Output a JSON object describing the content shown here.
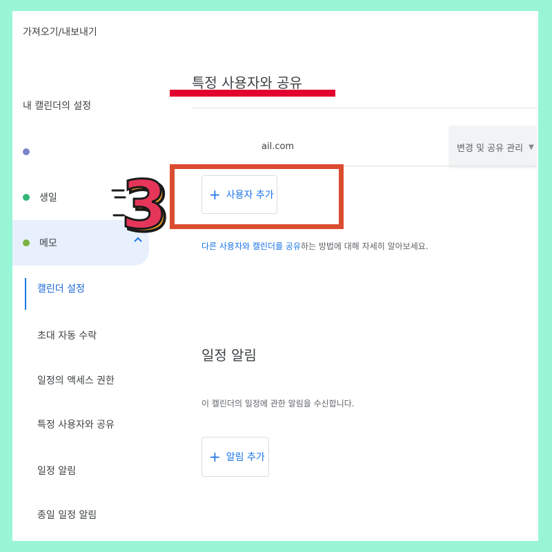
{
  "sidebar": {
    "top_link": "가져오기/내보내기",
    "section_title": "내 캘린더의 설정",
    "calendars": [
      {
        "label": "",
        "color": "#7986cb"
      },
      {
        "label": "생일",
        "color": "#33b679"
      },
      {
        "label": "메모",
        "color": "#7cb342"
      }
    ],
    "expand_icon": "chevron-up-icon",
    "sub_items": [
      "캘린더 설정",
      "초대 자동 수락",
      "일정의 액세스 권한",
      "특정 사용자와 공유",
      "일정 알림",
      "종일 일정 알림"
    ]
  },
  "main": {
    "share_section": {
      "title": "특정 사용자와 공유",
      "shared_email": "ail.com",
      "permission_label": "변경 및 공유 관리",
      "add_user_label": "사용자 추가",
      "info_link_text": "다른 사용자와 캘린더를 공유",
      "info_rest_text": "하는 방법에 대해 자세히 알아보세요."
    },
    "notif_section": {
      "title": "일정 알림",
      "description": "이 캘린더의 일정에 관한 알림을 수신합니다.",
      "add_notif_label": "알림 추가"
    }
  },
  "annotation": {
    "step_number": "3",
    "highlight_color": "#dc4c30",
    "underline_color": "#e2002e"
  },
  "colors": {
    "border": "#98f5d5",
    "accent": "#1a73e8"
  }
}
